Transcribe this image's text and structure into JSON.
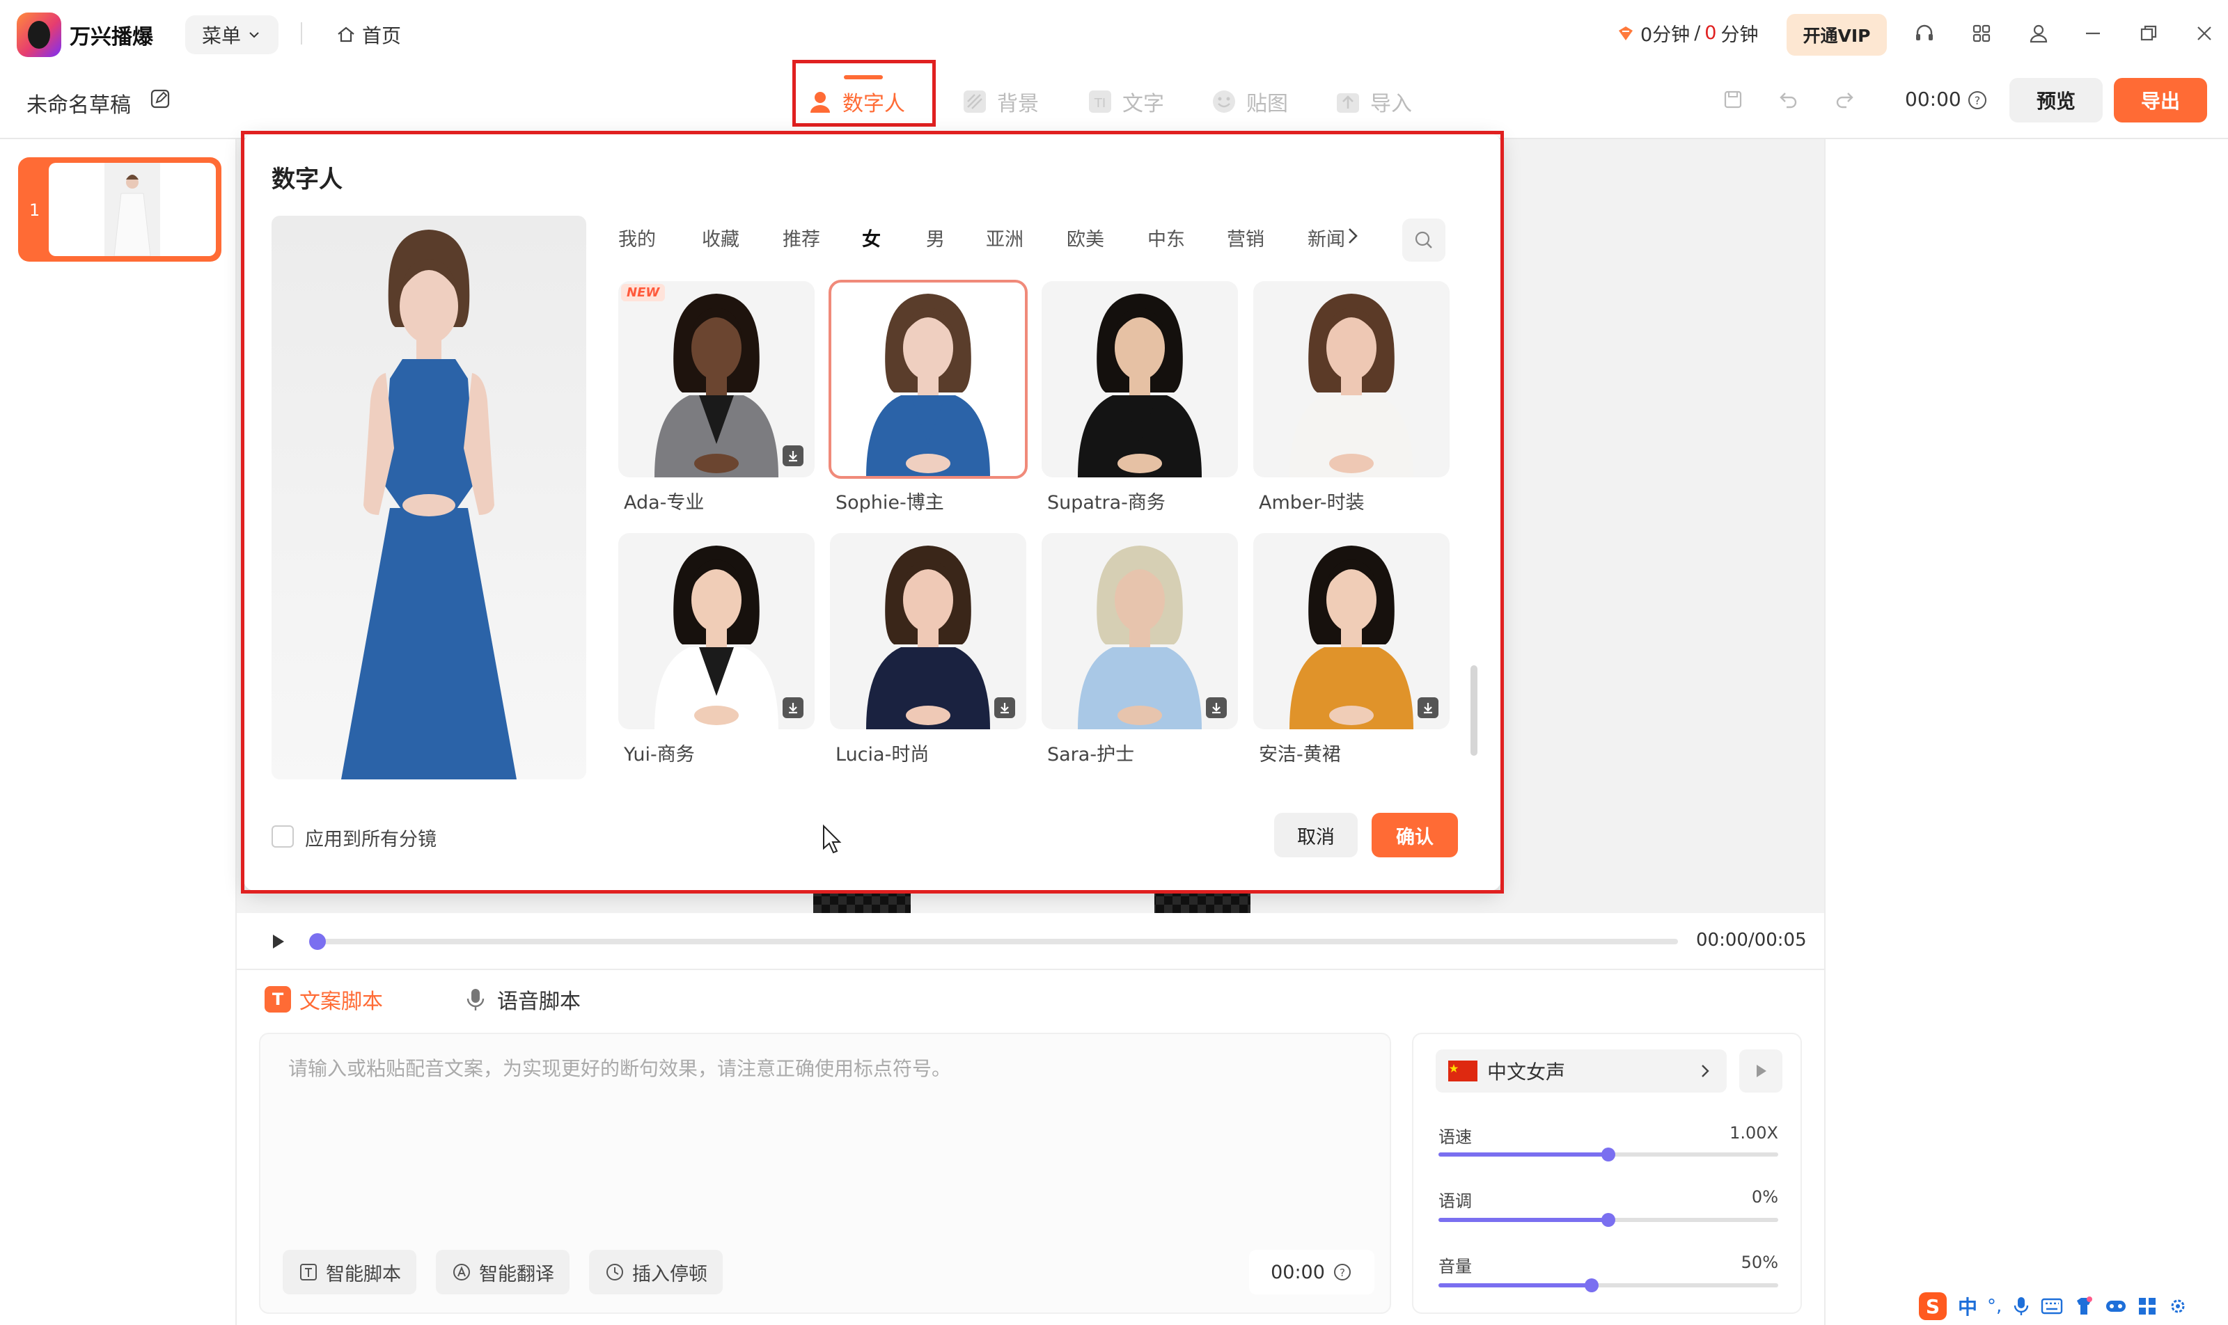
{
  "app": {
    "name": "万兴播爆",
    "menu_label": "菜单",
    "home_label": "首页",
    "draft_title": "未命名草稿",
    "quota_used": "0分钟",
    "quota_sep": "/",
    "quota_zero": "0",
    "quota_unit": "分钟",
    "vip_label": "开通VIP",
    "time": "00:00",
    "preview_label": "预览",
    "export_label": "导出"
  },
  "toptabs": [
    {
      "label": "数字人"
    },
    {
      "label": "背景"
    },
    {
      "label": "文字"
    },
    {
      "label": "贴图"
    },
    {
      "label": "导入"
    }
  ],
  "scene_list": [
    {
      "index": "1"
    }
  ],
  "dialog": {
    "title": "数字人",
    "categories": [
      "我的",
      "收藏",
      "推荐",
      "女",
      "男",
      "亚洲",
      "欧美",
      "中东",
      "营销",
      "新闻"
    ],
    "active_category": "女",
    "avatars": [
      {
        "name": "Ada-专业",
        "badge": "NEW",
        "selected": false,
        "skin": "#6b4530",
        "hair": "#1e130d",
        "outfit": "#7c7c80",
        "inner": "#1a1a1a"
      },
      {
        "name": "Sophie-博主",
        "badge": "",
        "selected": true,
        "skin": "#efcfc0",
        "hair": "#5a3d2b",
        "outfit": "#2b63a8",
        "inner": "#2b63a8"
      },
      {
        "name": "Supatra-商务",
        "badge": "",
        "selected": false,
        "skin": "#e6c1a4",
        "hair": "#14100d",
        "outfit": "#141414",
        "inner": "#141414"
      },
      {
        "name": "Amber-时装",
        "badge": "",
        "selected": false,
        "skin": "#eec8b4",
        "hair": "#5b3a27",
        "outfit": "#f5f4f2",
        "inner": "#f5f4f2"
      },
      {
        "name": "Yui-商务",
        "badge": "",
        "selected": false,
        "skin": "#f0cdb7",
        "hair": "#17110d",
        "outfit": "#ffffff",
        "inner": "#1b1b1b"
      },
      {
        "name": "Lucia-时尚",
        "badge": "",
        "selected": false,
        "skin": "#efc9b6",
        "hair": "#3a2619",
        "outfit": "#1a2240",
        "inner": "#1a2240"
      },
      {
        "name": "Sara-护士",
        "badge": "",
        "selected": false,
        "skin": "#e7c4ad",
        "hair": "#d6cfb4",
        "outfit": "#a9c8e6",
        "inner": "#a9c8e6"
      },
      {
        "name": "安洁-黄裙",
        "badge": "",
        "selected": false,
        "skin": "#f0cdb7",
        "hair": "#17110d",
        "outfit": "#e0932a",
        "inner": "#e0932a"
      }
    ],
    "apply_all_label": "应用到所有分镜",
    "cancel_label": "取消",
    "confirm_label": "确认"
  },
  "playback": {
    "time": "00:00/00:05",
    "progress": 0.0
  },
  "script": {
    "tabs": [
      {
        "label": "文案脚本"
      },
      {
        "label": "语音脚本"
      }
    ],
    "tab_icon_letter": "T",
    "placeholder": "请输入或粘贴配音文案，为实现更好的断句效果，请注意正确使用标点符号。",
    "tools": [
      {
        "label": "智能脚本"
      },
      {
        "label": "智能翻译"
      },
      {
        "label": "插入停顿"
      }
    ],
    "duration": "00:00"
  },
  "voice": {
    "name": "中文女声",
    "sliders": [
      {
        "label": "语速",
        "value": "1.00X",
        "level": 0.5
      },
      {
        "label": "语调",
        "value": "0%",
        "level": 0.5
      },
      {
        "label": "音量",
        "value": "50%",
        "level": 0.45
      }
    ]
  },
  "ime": {
    "mode": "中",
    "punct": "°,"
  },
  "colors": {
    "accent": "#ff6b35",
    "highlight": "#e02020",
    "slider": "#7a6ff0"
  }
}
